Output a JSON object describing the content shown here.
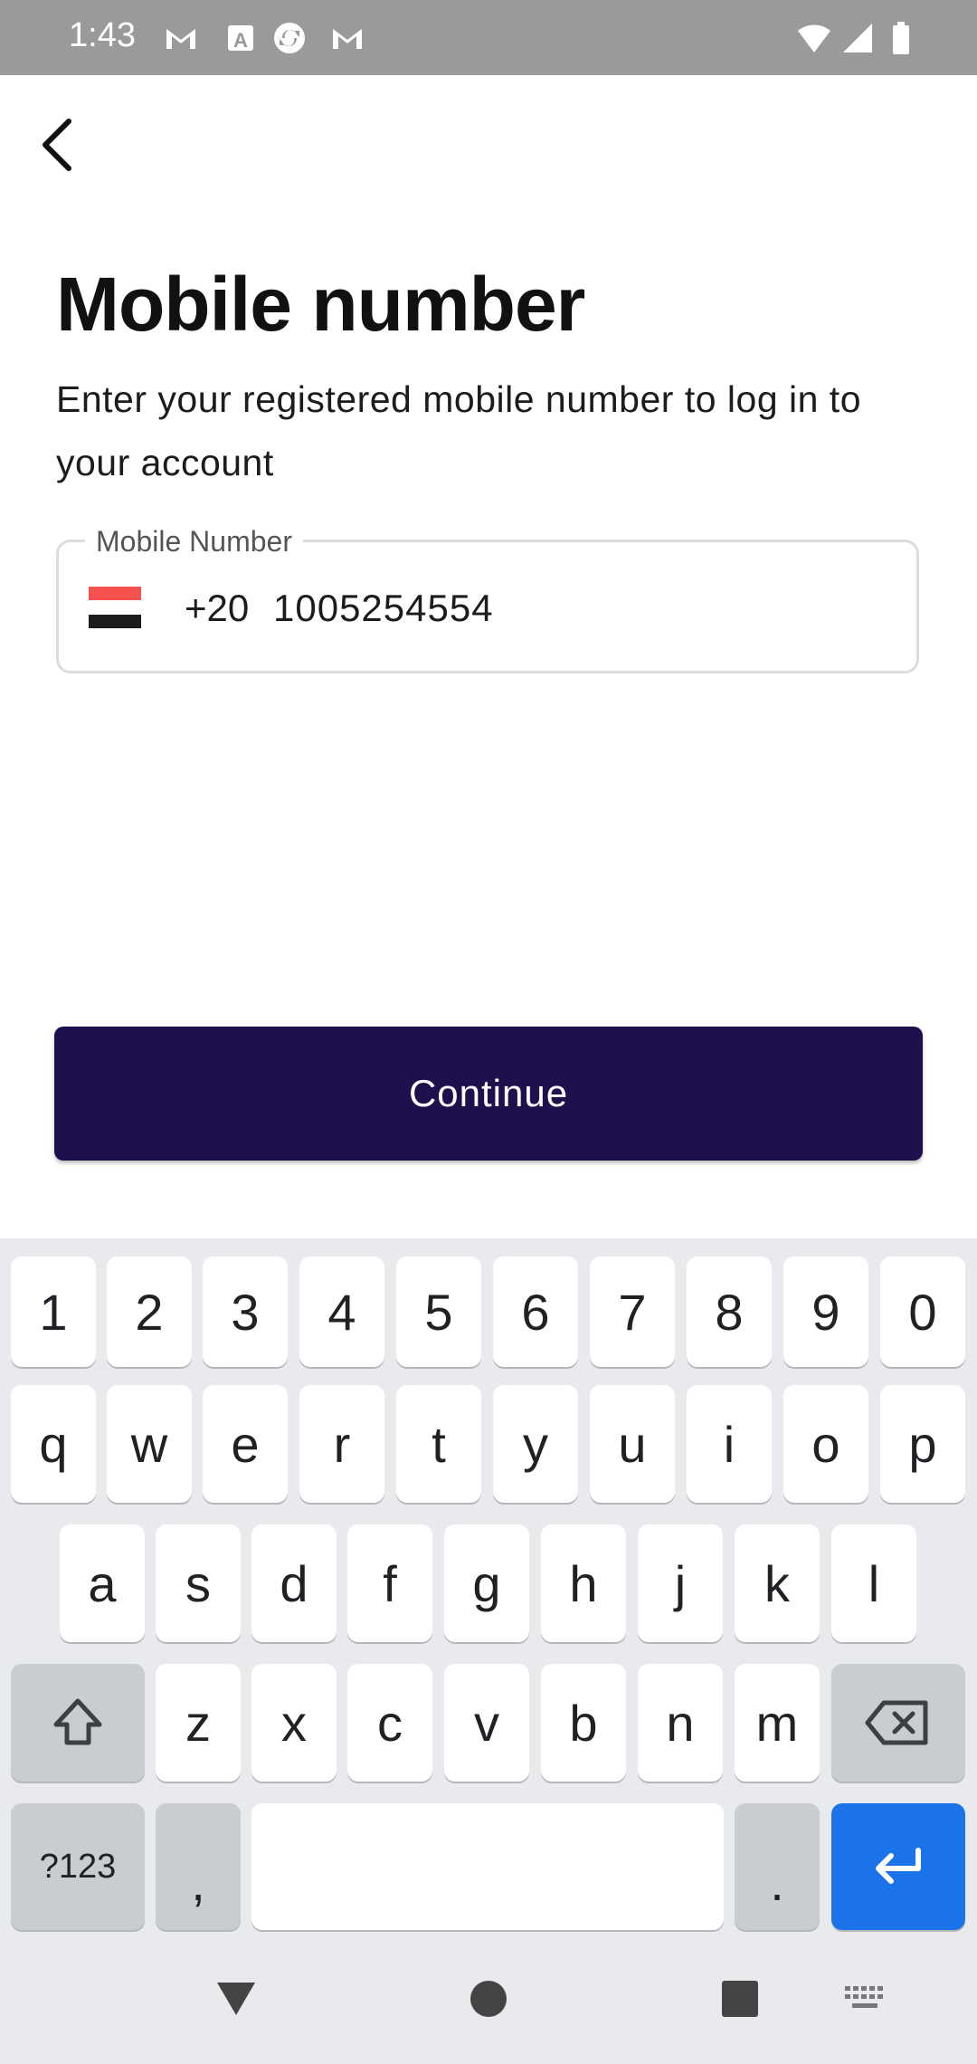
{
  "status_bar": {
    "time": "1:43",
    "icons": [
      "gmail-icon",
      "font-icon",
      "sync-app-icon",
      "gmail-icon",
      "wifi-icon",
      "signal-icon",
      "battery-icon"
    ]
  },
  "header": {
    "back_icon": "back-arrow-icon"
  },
  "title": "Mobile number",
  "subtitle": "Enter your registered mobile number to log in to your account",
  "phone_field": {
    "label": "Mobile Number",
    "country_flag": "egypt-flag",
    "country_code": "+20",
    "value": "1005254554"
  },
  "continue_label": "Continue",
  "colors": {
    "primary_button": "#1f0f4d",
    "enter_key": "#1a73e8",
    "status_bar": "#9a9a9a"
  },
  "keyboard": {
    "row_numbers": [
      "1",
      "2",
      "3",
      "4",
      "5",
      "6",
      "7",
      "8",
      "9",
      "0"
    ],
    "row_top": [
      "q",
      "w",
      "e",
      "r",
      "t",
      "y",
      "u",
      "i",
      "o",
      "p"
    ],
    "row_middle": [
      "a",
      "s",
      "d",
      "f",
      "g",
      "h",
      "j",
      "k",
      "l"
    ],
    "row_bottom": [
      "z",
      "x",
      "c",
      "v",
      "b",
      "n",
      "m"
    ],
    "symbols_label": "?123",
    "comma": ",",
    "period": "."
  },
  "nav_bar": {
    "icons": [
      "back-triangle-icon",
      "home-circle-icon",
      "recents-square-icon",
      "keyboard-icon"
    ]
  }
}
